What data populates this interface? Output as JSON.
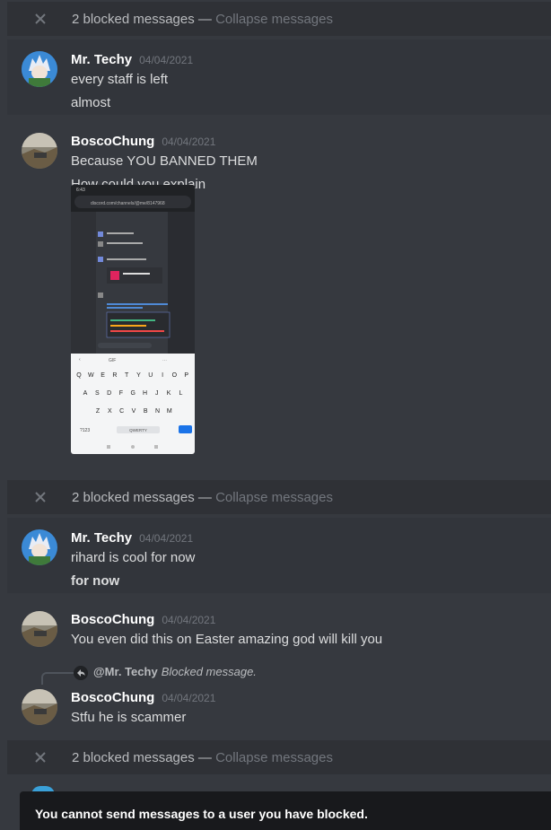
{
  "blocked": {
    "label": "2 blocked messages",
    "separator": " — ",
    "collapse": "Collapse messages"
  },
  "group1": {
    "author": "Mr. Techy",
    "timestamp": "04/04/2021",
    "lines": [
      "every staff is left",
      "almost"
    ]
  },
  "group2": {
    "author": "BoscoChung",
    "timestamp": "04/04/2021",
    "lines": [
      "Because YOU BANNED THEM",
      "How could you explain"
    ],
    "attachment": {
      "status_time": "6:43",
      "url": "discord.com/channels/@me/8147968",
      "keyboard_rows": [
        [
          "Q",
          "W",
          "E",
          "R",
          "T",
          "Y",
          "U",
          "I",
          "O",
          "P"
        ],
        [
          "A",
          "S",
          "D",
          "F",
          "G",
          "H",
          "J",
          "K",
          "L"
        ],
        [
          "Z",
          "X",
          "C",
          "V",
          "B",
          "N",
          "M"
        ]
      ],
      "kb_numbers": "?123",
      "kb_space": "QWERTY",
      "kb_tool_gif": "GIF"
    }
  },
  "group3": {
    "author": "Mr. Techy",
    "timestamp": "04/04/2021",
    "lines": [
      "rihard is cool for now",
      "for now"
    ]
  },
  "group4": {
    "author": "BoscoChung",
    "timestamp": "04/04/2021",
    "lines": [
      "You even did this on Easter amazing god will kill you"
    ]
  },
  "reply": {
    "mention": "@Mr. Techy",
    "blocked": "Blocked message."
  },
  "group5": {
    "author": "BoscoChung",
    "timestamp": "04/04/2021",
    "lines": [
      "Stfu he is scammer"
    ]
  },
  "toast": "You cannot send messages to a user you have blocked.",
  "colors": {
    "background": "#36393f",
    "toast": "#18191c",
    "accent": "#3aa0d8"
  }
}
